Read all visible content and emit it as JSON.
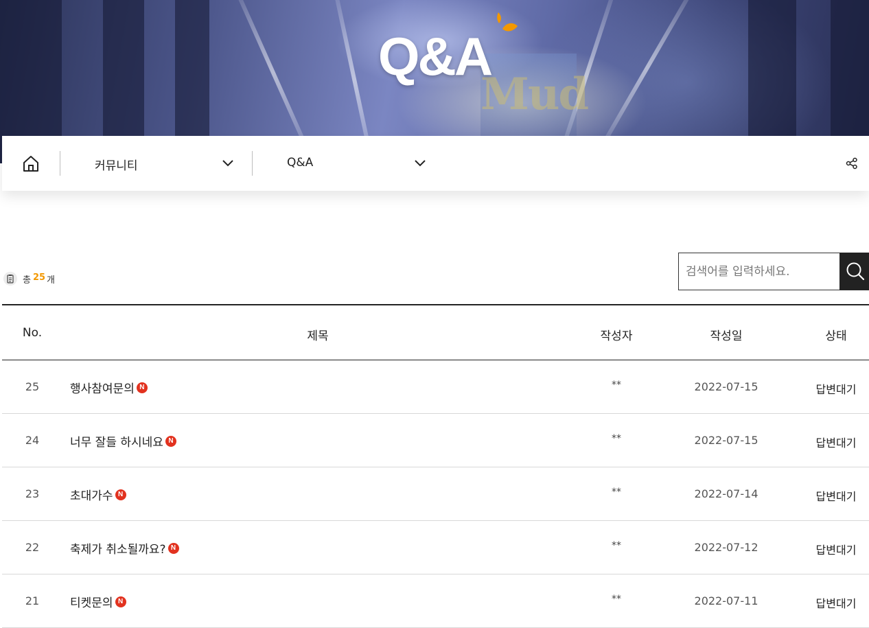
{
  "hero": {
    "title": "Q&A",
    "accent_color": "#f39800"
  },
  "breadcrumb": {
    "home_icon": "home-icon",
    "level1": {
      "label": "커뮤니티",
      "icon": "chevron-down-icon"
    },
    "level2": {
      "label": "Q&A",
      "icon": "chevron-down-icon"
    },
    "share_icon": "share-icon"
  },
  "summary": {
    "prefix": "총",
    "count": "25",
    "suffix": "개",
    "icon": "document-icon"
  },
  "search": {
    "placeholder": "검색어를 입력하세요.",
    "value": "",
    "icon": "search-icon"
  },
  "table": {
    "headers": {
      "no": "No.",
      "title": "제목",
      "writer": "작성자",
      "date": "작성일",
      "status": "상태"
    },
    "new_badge": "N",
    "rows": [
      {
        "no": "25",
        "title": "행사참여문의",
        "writer": "**",
        "date": "2022-07-15",
        "status": "답변대기"
      },
      {
        "no": "24",
        "title": "너무 잘들 하시네요",
        "writer": "**",
        "date": "2022-07-15",
        "status": "답변대기"
      },
      {
        "no": "23",
        "title": "초대가수",
        "writer": "**",
        "date": "2022-07-14",
        "status": "답변대기"
      },
      {
        "no": "22",
        "title": "축제가 취소될까요?",
        "writer": "**",
        "date": "2022-07-12",
        "status": "답변대기"
      },
      {
        "no": "21",
        "title": "티켓문의",
        "writer": "**",
        "date": "2022-07-11",
        "status": "답변대기"
      }
    ]
  }
}
